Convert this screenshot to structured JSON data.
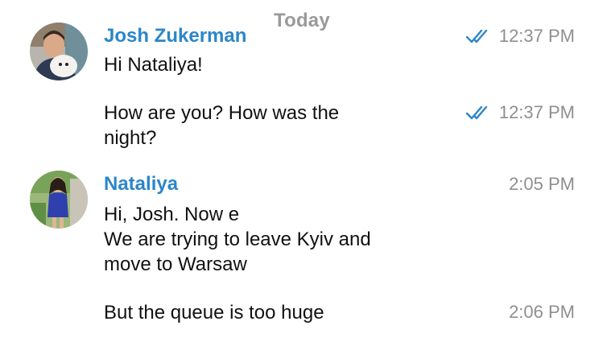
{
  "date_separator": "Today",
  "accent_color": "#2b86c9",
  "messages": [
    {
      "sender": "Josh Zukerman",
      "text": "Hi Nataliya!",
      "time": "12:37 PM",
      "read_icon": "double-check-icon"
    },
    {
      "text": "How are you? How was the\nnight?",
      "time": "12:37 PM",
      "read_icon": "double-check-icon"
    },
    {
      "sender": "Nataliya",
      "text": "Hi, Josh. Now e\nWe are trying to leave Kyiv  and\nmove to Warsaw",
      "time": "2:05 PM"
    },
    {
      "text": "But the queue is too huge",
      "time": "2:06 PM"
    }
  ]
}
